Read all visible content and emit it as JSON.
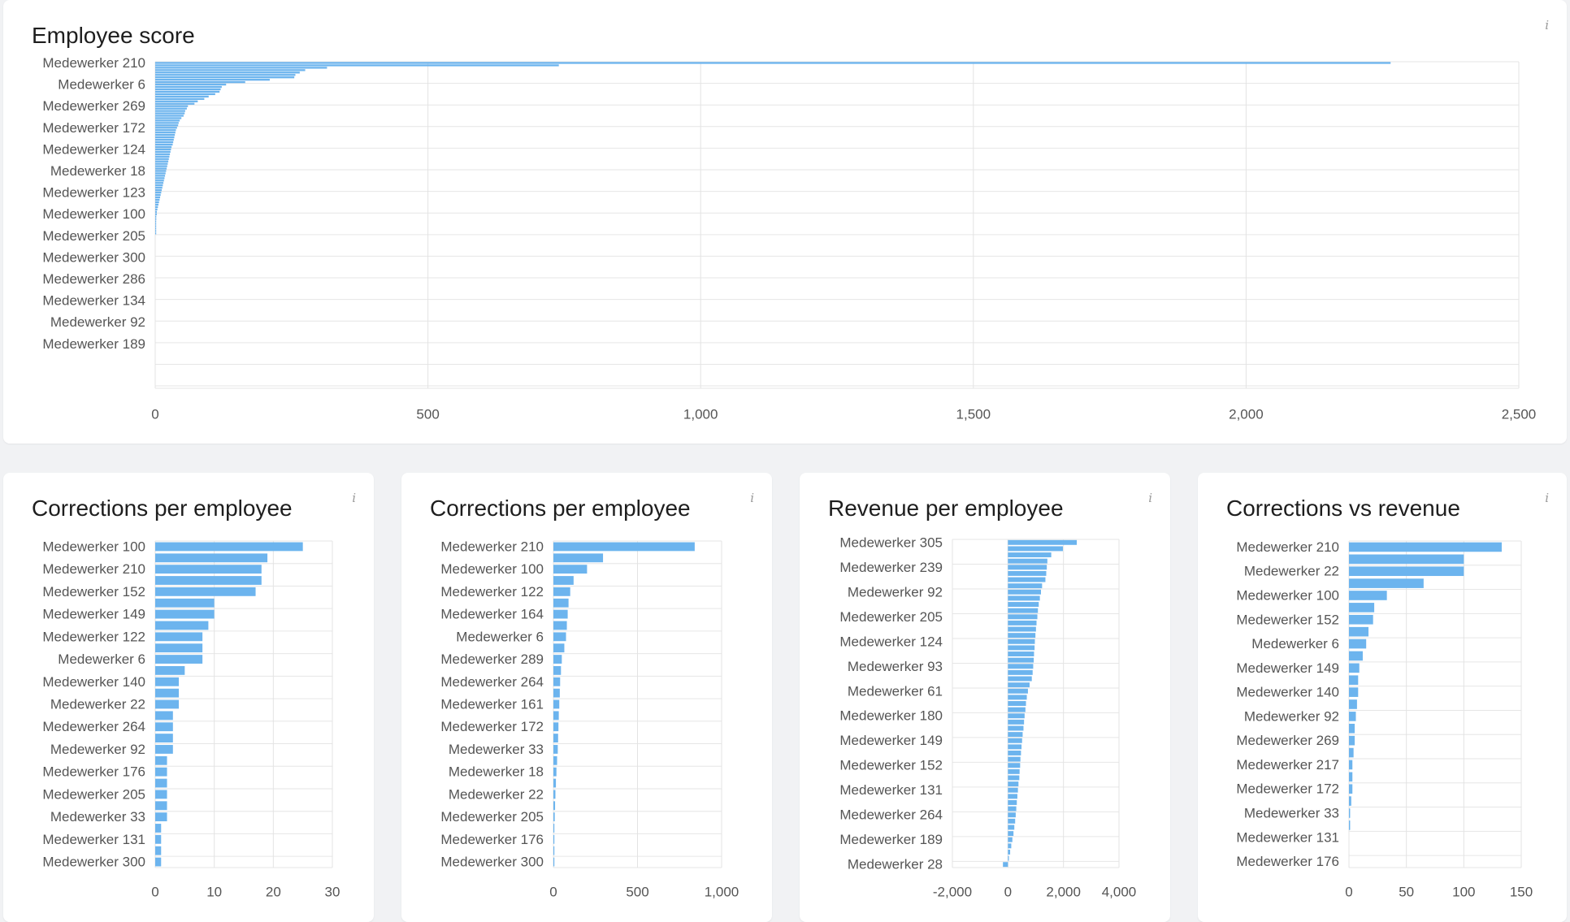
{
  "panels": [
    {
      "id": "employee-score",
      "title": "Employee score",
      "info_label": "i",
      "chart_data": {
        "type": "bar",
        "orientation": "horizontal",
        "title": "Employee score",
        "xlim": [
          0,
          2500
        ],
        "xticks": [
          "0",
          "500",
          "1,000",
          "1,500",
          "2,000",
          "2,500"
        ],
        "xtick_values": [
          0,
          500,
          1000,
          1500,
          2000,
          2500
        ],
        "category_count": 136,
        "label_every": 9,
        "labels": [
          "Medewerker 210",
          "Medewerker 6",
          "Medewerker 269",
          "Medewerker 172",
          "Medewerker 124",
          "Medewerker 18",
          "Medewerker 123",
          "Medewerker 100",
          "Medewerker 205",
          "Medewerker 300",
          "Medewerker 286",
          "Medewerker 134",
          "Medewerker 92",
          "Medewerker 189"
        ],
        "values": [
          2265,
          740,
          315,
          275,
          265,
          257,
          255,
          210,
          165,
          130,
          122,
          120,
          118,
          110,
          98,
          90,
          78,
          72,
          60,
          58,
          55,
          54,
          52,
          48,
          45,
          43,
          42,
          40,
          38,
          37,
          36,
          35,
          34,
          33,
          32,
          30,
          29,
          28,
          27,
          26,
          25,
          24,
          23,
          22,
          21,
          20,
          19,
          18,
          17,
          16,
          15,
          14,
          13,
          12,
          11,
          10,
          9,
          8,
          7,
          6,
          5,
          4,
          3,
          3,
          2,
          2,
          1,
          1,
          1,
          1,
          1,
          1,
          0,
          0,
          0,
          0,
          0,
          0,
          0,
          0,
          0,
          0,
          0,
          0,
          0,
          0,
          0,
          0,
          0,
          0,
          0,
          0,
          0,
          0,
          0,
          0,
          0,
          0,
          0,
          0,
          0,
          0,
          0,
          0,
          0,
          0,
          0,
          0,
          0,
          0,
          0,
          0,
          0,
          0,
          0,
          0,
          0,
          0,
          0,
          0,
          0,
          0,
          0,
          0,
          0,
          0,
          0,
          0,
          0,
          0,
          0,
          0,
          0,
          0,
          0,
          0
        ],
        "bar_color": "#6cb4ee"
      }
    },
    {
      "id": "corrections-per-employee-1",
      "title": "Corrections per employee",
      "info_label": "i",
      "chart_data": {
        "type": "bar",
        "orientation": "horizontal",
        "title": "Corrections per employee",
        "xlim": [
          0,
          30
        ],
        "xticks": [
          "0",
          "10",
          "20",
          "30"
        ],
        "xtick_values": [
          0,
          10,
          20,
          30
        ],
        "category_count": 29,
        "label_every": 2,
        "labels": [
          "Medewerker 100",
          "Medewerker 210",
          "Medewerker 152",
          "Medewerker 149",
          "Medewerker 122",
          "Medewerker 6",
          "Medewerker 140",
          "Medewerker 22",
          "Medewerker 264",
          "Medewerker 92",
          "Medewerker 176",
          "Medewerker 205",
          "Medewerker 33",
          "Medewerker 131",
          "Medewerker 300"
        ],
        "values": [
          25,
          19,
          18,
          18,
          17,
          10,
          10,
          9,
          8,
          8,
          8,
          5,
          4,
          4,
          4,
          3,
          3,
          3,
          3,
          2,
          2,
          2,
          2,
          2,
          2,
          1,
          1,
          1,
          1
        ],
        "bar_color": "#6cb4ee"
      }
    },
    {
      "id": "corrections-per-employee-2",
      "title": "Corrections per employee",
      "info_label": "i",
      "chart_data": {
        "type": "bar",
        "orientation": "horizontal",
        "title": "Corrections per employee",
        "xlim": [
          0,
          1000
        ],
        "xticks": [
          "0",
          "500",
          "1,000"
        ],
        "xtick_values": [
          0,
          500,
          1000
        ],
        "category_count": 29,
        "label_every": 2,
        "labels": [
          "Medewerker 210",
          "Medewerker 100",
          "Medewerker 122",
          "Medewerker 164",
          "Medewerker 6",
          "Medewerker 289",
          "Medewerker 264",
          "Medewerker 161",
          "Medewerker 172",
          "Medewerker 33",
          "Medewerker 18",
          "Medewerker 22",
          "Medewerker 205",
          "Medewerker 176",
          "Medewerker 300"
        ],
        "values": [
          840,
          295,
          200,
          120,
          100,
          90,
          85,
          80,
          75,
          65,
          50,
          45,
          40,
          38,
          35,
          32,
          30,
          28,
          26,
          22,
          18,
          15,
          12,
          10,
          8,
          5,
          3,
          2,
          1
        ],
        "bar_color": "#6cb4ee"
      }
    },
    {
      "id": "revenue-per-employee",
      "title": "Revenue per employee",
      "info_label": "i",
      "chart_data": {
        "type": "bar",
        "orientation": "horizontal",
        "title": "Revenue per employee",
        "xlim": [
          -2000,
          4000
        ],
        "xticks": [
          "-2,000",
          "0",
          "2,000",
          "4,000"
        ],
        "xtick_values": [
          -2000,
          0,
          2000,
          4000
        ],
        "category_count": 53,
        "label_every": 4,
        "labels": [
          "Medewerker 305",
          "Medewerker 239",
          "Medewerker 92",
          "Medewerker 205",
          "Medewerker 124",
          "Medewerker 93",
          "Medewerker 61",
          "Medewerker 180",
          "Medewerker 149",
          "Medewerker 152",
          "Medewerker 131",
          "Medewerker 264",
          "Medewerker 189",
          "Medewerker 28"
        ],
        "values": [
          2480,
          1980,
          1560,
          1420,
          1400,
          1380,
          1350,
          1230,
          1190,
          1150,
          1110,
          1080,
          1060,
          1030,
          1010,
          990,
          970,
          960,
          940,
          930,
          910,
          890,
          860,
          780,
          720,
          680,
          650,
          630,
          600,
          580,
          560,
          530,
          510,
          490,
          470,
          450,
          440,
          420,
          410,
          380,
          360,
          340,
          320,
          300,
          280,
          260,
          230,
          200,
          160,
          120,
          80,
          30,
          -180
        ],
        "bar_color": "#6cb4ee"
      }
    },
    {
      "id": "corrections-vs-revenue",
      "title": "Corrections vs revenue",
      "info_label": "i",
      "chart_data": {
        "type": "bar",
        "orientation": "horizontal",
        "title": "Corrections vs revenue",
        "xlim": [
          0,
          150
        ],
        "xticks": [
          "0",
          "50",
          "100",
          "150"
        ],
        "xtick_values": [
          0,
          50,
          100,
          150
        ],
        "category_count": 27,
        "label_every": 2,
        "labels": [
          "Medewerker 210",
          "Medewerker 22",
          "Medewerker 100",
          "Medewerker 152",
          "Medewerker 6",
          "Medewerker 149",
          "Medewerker 140",
          "Medewerker 92",
          "Medewerker 269",
          "Medewerker 217",
          "Medewerker 172",
          "Medewerker 33",
          "Medewerker 131",
          "Medewerker 176"
        ],
        "values": [
          133,
          100,
          100,
          65,
          33,
          22,
          21,
          17,
          15,
          12,
          9,
          8,
          8,
          7,
          6,
          5,
          5,
          4,
          3,
          3,
          3,
          2,
          1,
          1,
          0,
          0,
          0
        ],
        "bar_color": "#6cb4ee"
      }
    }
  ]
}
